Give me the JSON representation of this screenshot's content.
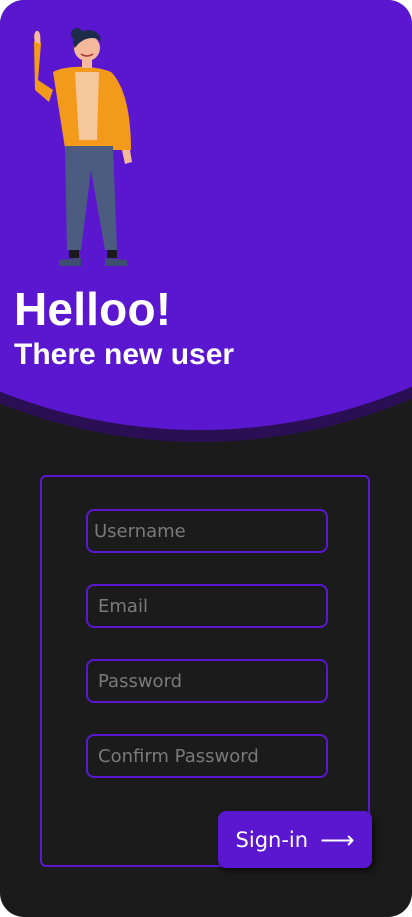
{
  "header": {
    "title": "Helloo!",
    "subtitle": "There new user"
  },
  "form": {
    "username_placeholder": "Username",
    "email_placeholder": "Email",
    "password_placeholder": "Password",
    "confirm_password_placeholder": "Confirm Password",
    "signin_label": "Sign-in",
    "signin_arrow": "⟶"
  },
  "colors": {
    "accent": "#5b17cf",
    "background": "#1b1b1b",
    "text": "#ffffff",
    "placeholder": "#7a7a7a"
  },
  "icons": {
    "illustration": "waving-person-illustration",
    "signin": "arrow-right-icon"
  }
}
